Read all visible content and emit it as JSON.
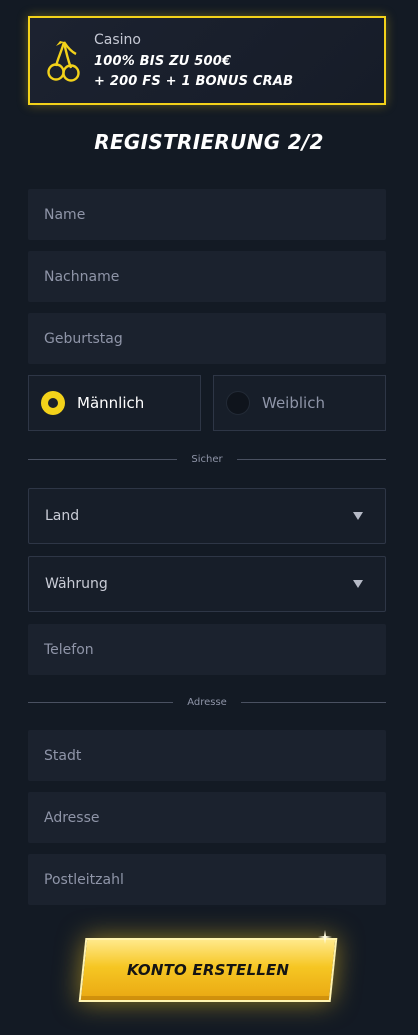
{
  "banner": {
    "type": "Casino",
    "line1": "100% BIS ZU 500€",
    "line2": "+ 200 FS + 1 BONUS CRAB",
    "icon": "cherry-icon",
    "accent": "#f3d21a"
  },
  "title": "REGISTRIERUNG 2/2",
  "fields": {
    "name": "Name",
    "nachname": "Nachname",
    "geburtstag": "Geburtstag"
  },
  "gender": {
    "male": "Männlich",
    "female": "Weiblich",
    "selected": "male"
  },
  "dividers": {
    "secure": "Sicher",
    "address": "Adresse"
  },
  "selects": {
    "country": "Land",
    "currency": "Währung"
  },
  "phone": "Telefon",
  "address": {
    "city": "Stadt",
    "street": "Adresse",
    "zip": "Postleitzahl"
  },
  "cta": "KONTO ERSTELLEN"
}
